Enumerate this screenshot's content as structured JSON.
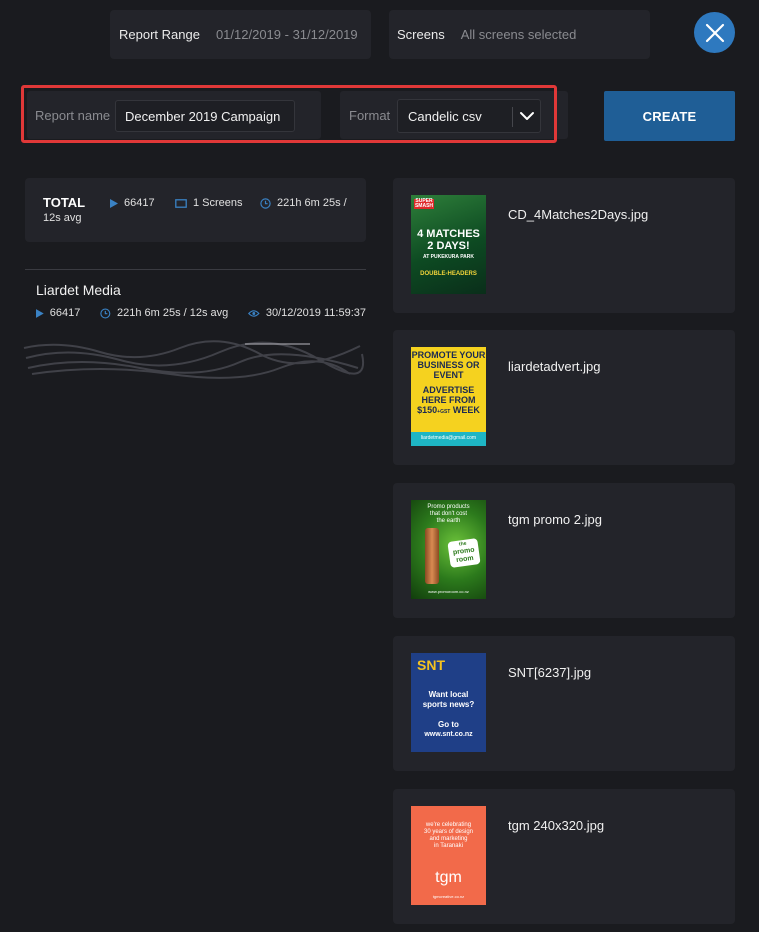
{
  "filters": {
    "range_label": "Report Range",
    "range_value": "01/12/2019 - 31/12/2019",
    "screens_label": "Screens",
    "screens_value": "All screens selected"
  },
  "form": {
    "report_name_label": "Report name",
    "report_name_value": "December 2019 Campaign",
    "format_label": "Format",
    "format_value": "Candelic csv",
    "create_label": "CREATE"
  },
  "totals": {
    "title": "TOTAL",
    "plays": "66417",
    "screens": "1 Screens",
    "duration": "221h 6m 25s /",
    "avg": "12s avg"
  },
  "media": {
    "name": "Liardet Media",
    "plays": "66417",
    "duration": "221h 6m 25s / 12s avg",
    "last_seen": "30/12/2019 11:59:37"
  },
  "assets": [
    {
      "filename": "CD_4Matches2Days.jpg",
      "thumb": {
        "top": "SUPER SMASH",
        "headline1": "4 MATCHES",
        "headline2": "2 DAYS!",
        "sub": "AT PUKEKURA PARK",
        "footer": "DOUBLE-HEADERS"
      }
    },
    {
      "filename": "liardetadvert.jpg",
      "thumb": {
        "l1": "PROMOTE YOUR",
        "l2": "BUSINESS OR",
        "l3": "EVENT",
        "l4": "ADVERTISE",
        "l5": "HERE FROM",
        "l6": "$150",
        "l7": "+GST",
        "l8": "WEEK",
        "email": "liardetmedia@gmail.com"
      }
    },
    {
      "filename": "tgm promo 2.jpg",
      "thumb": {
        "l1": "Promo products",
        "l2": "that don't cost",
        "l3": "the earth",
        "badge1": "the",
        "badge2": "promo",
        "badge3": "room",
        "url": "www.promoroom.co.nz"
      }
    },
    {
      "filename": "SNT[6237].jpg",
      "thumb": {
        "logo": "SNT",
        "l1": "Want local",
        "l2": "sports news?",
        "l3": "Go to",
        "l4": "www.snt.co.nz"
      }
    },
    {
      "filename": "tgm 240x320.jpg",
      "thumb": {
        "l1": "we're celebrating",
        "l2": "30 years of design",
        "l3": "and marketing",
        "l4": "in Taranaki",
        "logo": "tgm",
        "url": "tgmcreative.co.nz"
      }
    }
  ],
  "colors": {
    "background": "#1a1b1f",
    "card": "#23242a",
    "accent": "#2e79bf",
    "create": "#1f5e96",
    "highlight": "#e03838"
  }
}
